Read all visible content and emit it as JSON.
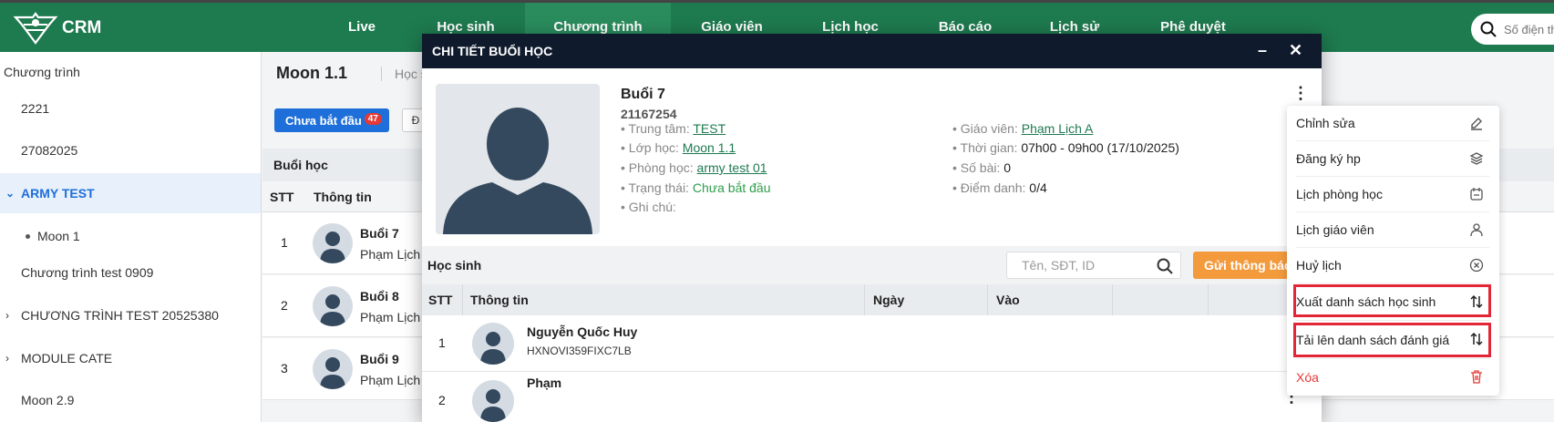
{
  "app": {
    "logo_text": "CRM"
  },
  "nav": [
    "Live",
    "Học sinh",
    "Chương trình",
    "Giáo viên",
    "Lịch học",
    "Báo cáo",
    "Lịch sử",
    "Phê duyệt"
  ],
  "search": {
    "placeholder": "Số điện th"
  },
  "sidebar": {
    "title": "Chương trình",
    "items": [
      {
        "label": "2221"
      },
      {
        "label": "27082025"
      },
      {
        "label": "ARMY TEST",
        "active": true
      },
      {
        "label": "Moon 1"
      },
      {
        "label": "Chương trình test 0909"
      },
      {
        "label": "CHƯƠNG TRÌNH TEST 20525380"
      },
      {
        "label": "MODULE CATE"
      },
      {
        "label": "Moon 2.9"
      }
    ]
  },
  "bg": {
    "title": "Moon 1.1",
    "subtitle": "Học sinh",
    "status_button": "Chưa bắt đầu",
    "status_count": "47",
    "small_button": "Đ",
    "section": "Buổi học",
    "col_stt": "STT",
    "col_info": "Thông tin",
    "rows": [
      {
        "stt": "1",
        "name": "Buổi 7",
        "teacher": "Phạm Lịch A"
      },
      {
        "stt": "2",
        "name": "Buổi 8",
        "teacher": "Phạm Lịch A"
      },
      {
        "stt": "3",
        "name": "Buổi 9",
        "teacher": "Phạm Lịch A"
      }
    ]
  },
  "modal": {
    "title": "CHI TIẾT BUỔI HỌC",
    "session_name": "Buổi 7",
    "session_id": "21167254",
    "left": {
      "center_label": "Trung tâm:",
      "center_value": "TEST",
      "class_label": "Lớp học:",
      "class_value": "Moon 1.1",
      "room_label": "Phòng học:",
      "room_value": "army test 01",
      "status_label": "Trạng thái:",
      "status_value": "Chưa bắt đầu",
      "note_label": "Ghi chú:"
    },
    "right": {
      "teacher_label": "Giáo viên:",
      "teacher_value": "Phạm Lịch A",
      "time_label": "Thời gian:",
      "time_value": "07h00 - 09h00 (17/10/2025)",
      "lessons_label": "Số bài:",
      "lessons_value": "0",
      "attendance_label": "Điểm danh:",
      "attendance_value": "0/4"
    },
    "students_label": "Học sinh",
    "search_placeholder": "Tên, SĐT, ID",
    "send_button": "Gửi thông báo",
    "col_stt": "STT",
    "col_info": "Thông tin",
    "col_day": "Ngày",
    "col_in": "Vào",
    "students": [
      {
        "stt": "1",
        "name": "Nguyễn Quốc Huy",
        "code": "HXNOVI359FIXC7LB"
      },
      {
        "stt": "2",
        "name": "Phạm",
        "code": ""
      }
    ]
  },
  "menu": {
    "items": [
      {
        "label": "Chỉnh sửa",
        "icon": "edit-icon"
      },
      {
        "label": "Đăng ký hp",
        "icon": "layers-icon"
      },
      {
        "label": "Lịch phòng học",
        "icon": "calendar-icon"
      },
      {
        "label": "Lịch giáo viên",
        "icon": "user-icon"
      },
      {
        "label": "Huỷ lịch",
        "icon": "cancel-circle-icon"
      },
      {
        "label": "Xuất danh sách học sinh",
        "icon": "sort-arrows-icon"
      },
      {
        "label": "Tải lên danh sách đánh giá",
        "icon": "sort-arrows-icon"
      },
      {
        "label": "Xóa",
        "icon": "trash-icon"
      }
    ]
  },
  "colors": {
    "header": "#1e7a4f",
    "primary": "#1e6fd9",
    "danger": "#e53935",
    "orange": "#f39a3d",
    "modal_bar": "#0f1b2d",
    "highlight": "#e32636"
  }
}
